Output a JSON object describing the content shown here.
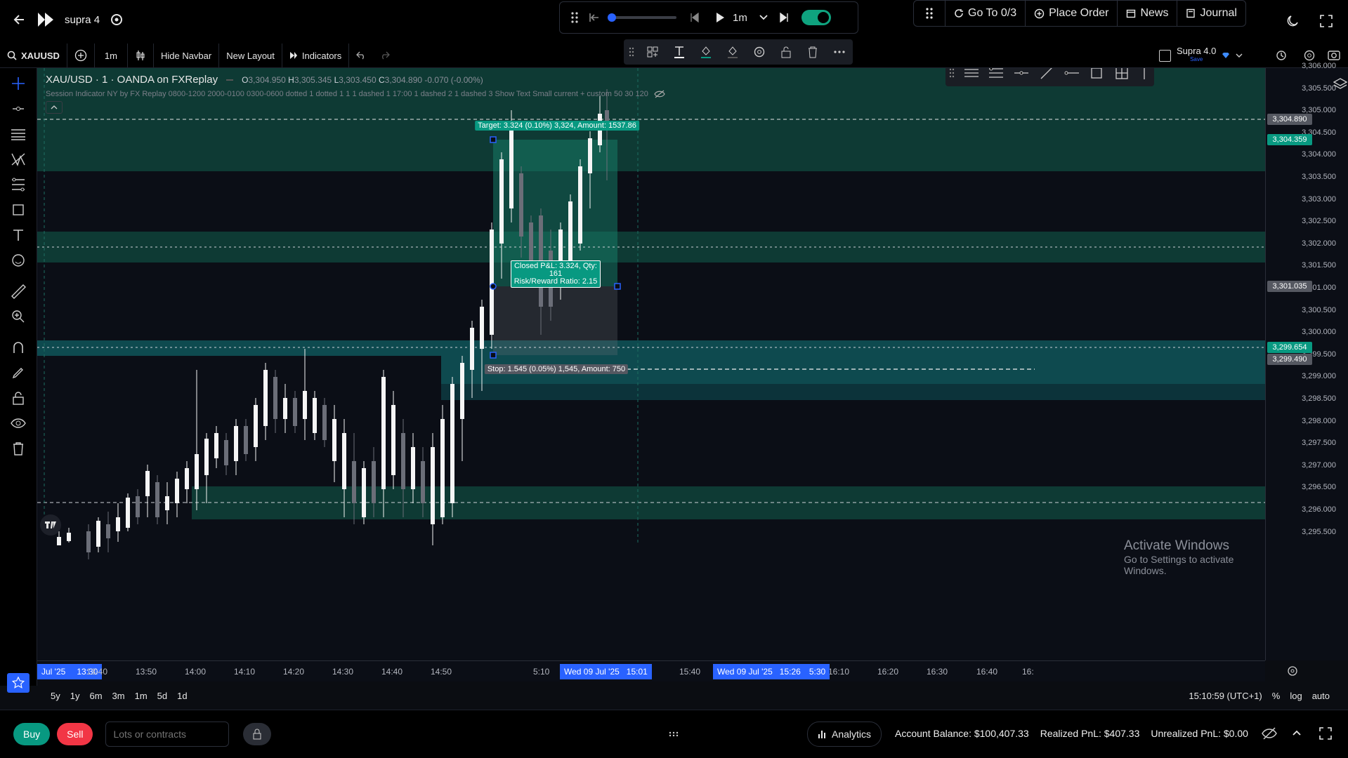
{
  "app": {
    "workspace_name": "supra 4"
  },
  "playback": {
    "timeframe": "1m"
  },
  "topnav": {
    "goto_label": "Go To 0/3",
    "place_order_label": "Place Order",
    "news_label": "News",
    "journal_label": "Journal"
  },
  "toolbar": {
    "symbol": "XAUUSD",
    "interval": "1m",
    "hide_navbar": "Hide Navbar",
    "new_layout": "New Layout",
    "indicators": "Indicators",
    "layout_name": "Supra 4.0",
    "layout_save": "Save"
  },
  "legend": {
    "title": "XAU/USD · 1 · OANDA on FXReplay",
    "o_label": "O",
    "o": "3,304.950",
    "h_label": "H",
    "h": "3,305.345",
    "l_label": "L",
    "l": "3,303.450",
    "c_label": "C",
    "c": "3,304.890",
    "change": "-0.070 (-0.00%)",
    "indicator": "Session Indicator NY by FX Replay 0800-1200 2000-0100 0300-0600 dotted 1 dotted 1 1 1 dashed 1 17:00 1 dashed 2 1 dashed 3 Show Text Small current + custom 50 30 120"
  },
  "position": {
    "target_label": "Target: 3.324 (0.10%) 3,324, Amount: 1537.86",
    "stop_label": "Stop: 1.545 (0.05%) 1,545, Amount: 750",
    "closed_pnl": "Closed P&L: 3.324, Qty: 161",
    "rr": "Risk/Reward Ratio: 2.15"
  },
  "price_axis": {
    "ticks": [
      "3,306.000",
      "3,305.500",
      "3,305.000",
      "3,304.500",
      "3,304.000",
      "3,303.500",
      "3,303.000",
      "3,302.500",
      "3,302.000",
      "3,301.500",
      "3,301.000",
      "3,300.500",
      "3,300.000",
      "3,299.500",
      "3,299.000",
      "3,298.500",
      "3,298.000",
      "3,297.500",
      "3,297.000",
      "3,296.500",
      "3,296.000",
      "3,295.500"
    ],
    "tag_last": "3,304.890",
    "tag_target": "3,304.359",
    "tag_entry": "3,301.035",
    "tag_green": "3,299.654",
    "tag_stop": "3,299.490"
  },
  "time_axis": {
    "left_date": "Jul '25",
    "left_time": "13:30",
    "ticks": [
      "13:40",
      "13:50",
      "14:00",
      "14:10",
      "14:20",
      "14:30",
      "14:40",
      "14:50",
      "5:10",
      "15:40",
      "15:50",
      "16:00",
      "16:10",
      "16:20",
      "16:30",
      "16:40",
      "16:"
    ],
    "cursor1": "Wed 09 Jul '25   15:01",
    "cursor2": "Wed 09 Jul '25   15:26",
    "cursor2_suffix": "5:30"
  },
  "ranges": [
    "5y",
    "1y",
    "6m",
    "3m",
    "1m",
    "5d",
    "1d"
  ],
  "status": {
    "clock": "15:10:59 (UTC+1)",
    "pct": "%",
    "log": "log",
    "auto": "auto"
  },
  "watermark": {
    "line1": "Activate Windows",
    "line2": "Go to Settings to activate Windows."
  },
  "bottom": {
    "buy": "Buy",
    "sell": "Sell",
    "lots_placeholder": "Lots or contracts",
    "analytics": "Analytics",
    "balance": "Account Balance: $100,407.33",
    "realized": "Realized PnL: $407.33",
    "unrealized": "Unrealized PnL: $0.00"
  },
  "colors": {
    "accent_green": "#089981",
    "blue": "#2962ff",
    "teal_zone": "#0f3b38",
    "toggle": "#0fa37f"
  }
}
